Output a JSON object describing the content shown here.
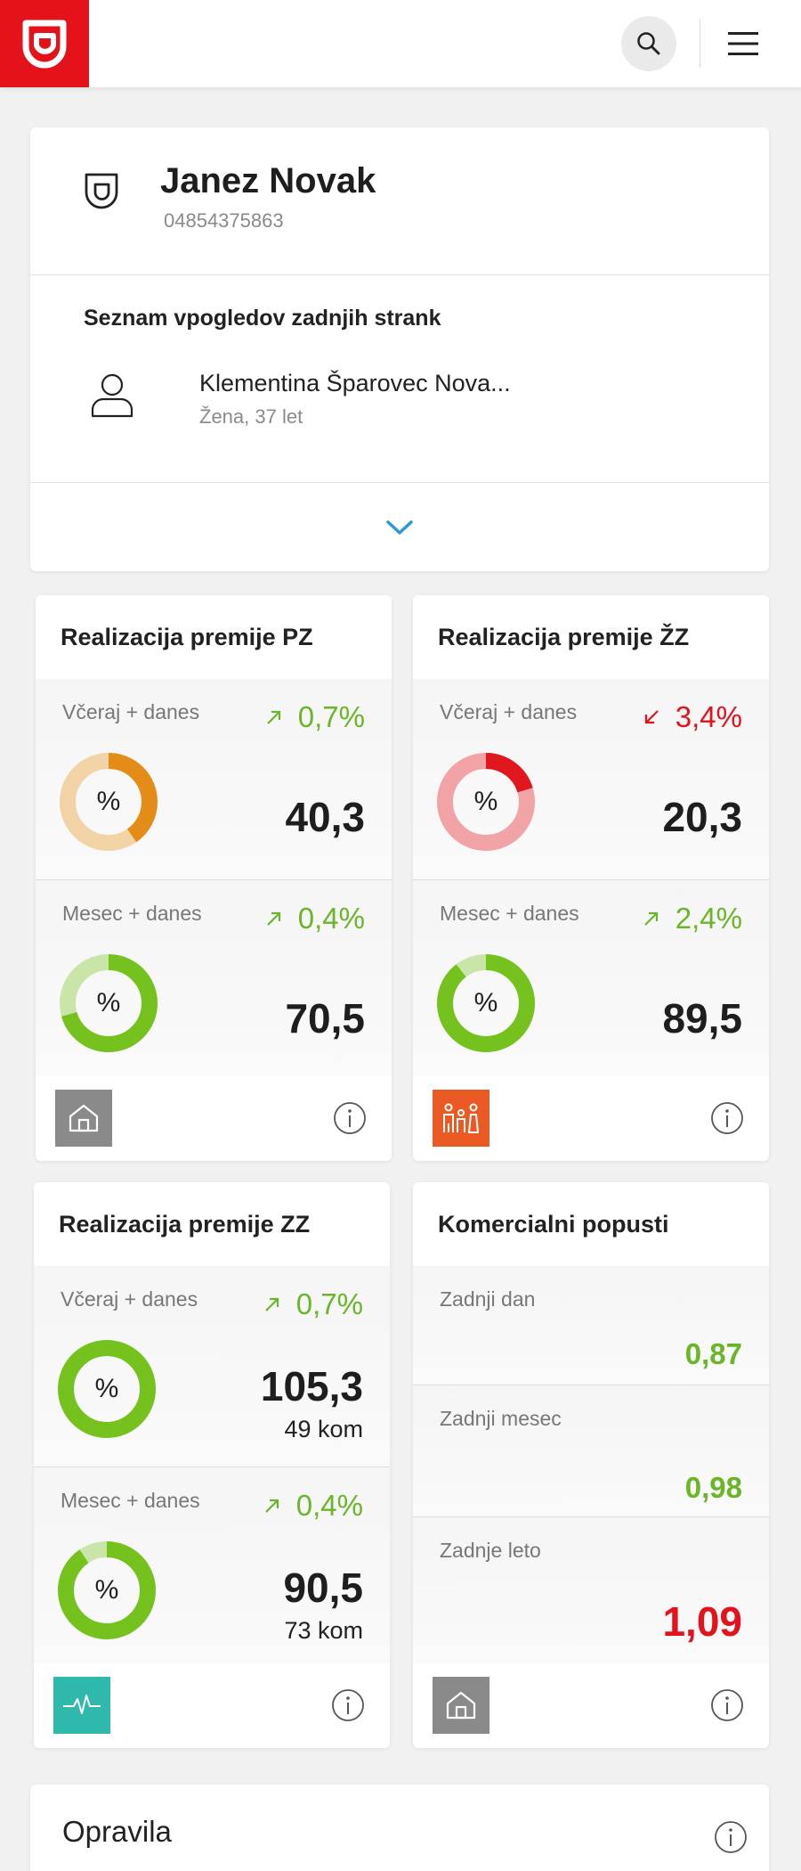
{
  "header": {
    "logo_icon": "triglav-shield-logo",
    "search_icon": "search-icon",
    "menu_icon": "hamburger-menu-icon",
    "brand_color": "#e3121b"
  },
  "profile": {
    "name": "Janez Novak",
    "id": "04854375863",
    "recent_title": "Seznam vpogledov zadnjih strank",
    "recent_items": [
      {
        "name": "Klementina Šparovec Nova...",
        "sub": "Žena, 37 let"
      }
    ]
  },
  "cards": [
    {
      "title": "Realizacija premije PZ",
      "footer_icon": "house-icon",
      "footer_color": "#8a8a8a",
      "sections": [
        {
          "label": "Včeraj + danes",
          "trend": "0,7%",
          "direction": "up",
          "value": "40,3",
          "progress": 0.403,
          "ring_color": "#e38c18",
          "ring_track": "#f2d3a6"
        },
        {
          "label": "Mesec + danes",
          "trend": "0,4%",
          "direction": "up",
          "value": "70,5",
          "progress": 0.705,
          "ring_color": "#75c21f",
          "ring_track": "#c9e6a8"
        }
      ]
    },
    {
      "title": "Realizacija premije ŽZ",
      "footer_icon": "family-icon",
      "footer_color": "#ec5a24",
      "sections": [
        {
          "label": "Včeraj + danes",
          "trend": "3,4%",
          "direction": "down",
          "value": "20,3",
          "progress": 0.203,
          "ring_color": "#e0171d",
          "ring_track": "#f1a3a6"
        },
        {
          "label": "Mesec + danes",
          "trend": "2,4%",
          "direction": "up",
          "value": "89,5",
          "progress": 0.895,
          "ring_color": "#75c21f",
          "ring_track": "#c9e6a8"
        }
      ]
    },
    {
      "title": "Realizacija premije ZZ",
      "footer_icon": "heartbeat-icon",
      "footer_color": "#2fb8ac",
      "sections": [
        {
          "label": "Včeraj + danes",
          "trend": "0,7%",
          "direction": "up",
          "value": "105,3",
          "sub": "49 kom",
          "progress": 1.0,
          "ring_color": "#75c21f",
          "ring_track": "#c9e6a8"
        },
        {
          "label": "Mesec + danes",
          "trend": "0,4%",
          "direction": "up",
          "value": "90,5",
          "sub": "73 kom",
          "progress": 0.905,
          "ring_color": "#75c21f",
          "ring_track": "#c9e6a8"
        }
      ]
    }
  ],
  "discounts": {
    "title": "Komercialni popusti",
    "footer_icon": "house-icon",
    "footer_color": "#8a8a8a",
    "rows": [
      {
        "label": "Zadnji dan",
        "value": "0,87",
        "color": "#6ab528"
      },
      {
        "label": "Zadnji mesec",
        "value": "0,98",
        "color": "#6ab528"
      },
      {
        "label": "Zadnje leto",
        "value": "1,09",
        "color": "#e3121b"
      }
    ]
  },
  "tasks": {
    "title": "Opravila"
  },
  "percent_symbol": "%"
}
